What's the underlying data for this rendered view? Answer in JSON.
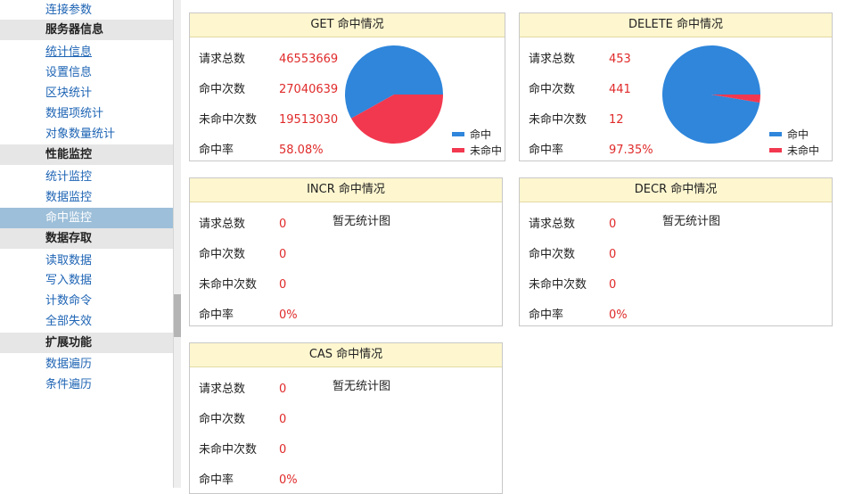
{
  "colors": {
    "hit": "#2f86db",
    "miss": "#f2384f",
    "value_text": "#e02a2a",
    "link": "#1e64b4",
    "panel_header_bg": "#fdf6cf",
    "active_bg": "#9dbfd9"
  },
  "sidebar": {
    "items": [
      {
        "label": "连接参数",
        "type": "link"
      },
      {
        "label": "服务器信息",
        "type": "header"
      },
      {
        "label": "统计信息",
        "type": "link"
      },
      {
        "label": "设置信息",
        "type": "link"
      },
      {
        "label": "区块统计",
        "type": "link"
      },
      {
        "label": "数据项统计",
        "type": "link"
      },
      {
        "label": "对象数量统计",
        "type": "link"
      },
      {
        "label": "性能监控",
        "type": "header"
      },
      {
        "label": "统计监控",
        "type": "link"
      },
      {
        "label": "数据监控",
        "type": "link"
      },
      {
        "label": "命中监控",
        "type": "active",
        "icon": "arrow-right-icon"
      },
      {
        "label": "数据存取",
        "type": "header"
      },
      {
        "label": "读取数据",
        "type": "link"
      },
      {
        "label": "写入数据",
        "type": "link"
      },
      {
        "label": "计数命令",
        "type": "link"
      },
      {
        "label": "全部失效",
        "type": "link"
      },
      {
        "label": "扩展功能",
        "type": "header"
      },
      {
        "label": "数据遍历",
        "type": "link"
      },
      {
        "label": "条件遍历",
        "type": "link"
      }
    ]
  },
  "labels": {
    "total": "请求总数",
    "hits": "命中次数",
    "misses": "未命中次数",
    "rate": "命中率",
    "no_chart": "暂无统计图",
    "legend_hit": "命中",
    "legend_miss": "未命中"
  },
  "panels": {
    "get": {
      "title": "GET 命中情况",
      "total": "46553669",
      "hits": "27040639",
      "misses": "19513030",
      "rate": "58.08%"
    },
    "delete": {
      "title": "DELETE 命中情况",
      "total": "453",
      "hits": "441",
      "misses": "12",
      "rate": "97.35%"
    },
    "incr": {
      "title": "INCR 命中情况",
      "total": "0",
      "hits": "0",
      "misses": "0",
      "rate": "0%"
    },
    "decr": {
      "title": "DECR 命中情况",
      "total": "0",
      "hits": "0",
      "misses": "0",
      "rate": "0%"
    },
    "cas": {
      "title": "CAS 命中情况",
      "total": "0",
      "hits": "0",
      "misses": "0",
      "rate": "0%"
    }
  },
  "chart_data": [
    {
      "type": "pie",
      "title": "GET 命中情况",
      "categories": [
        "命中",
        "未命中"
      ],
      "values": [
        27040639,
        19513030
      ]
    },
    {
      "type": "pie",
      "title": "DELETE 命中情况",
      "categories": [
        "命中",
        "未命中"
      ],
      "values": [
        441,
        12
      ]
    }
  ]
}
